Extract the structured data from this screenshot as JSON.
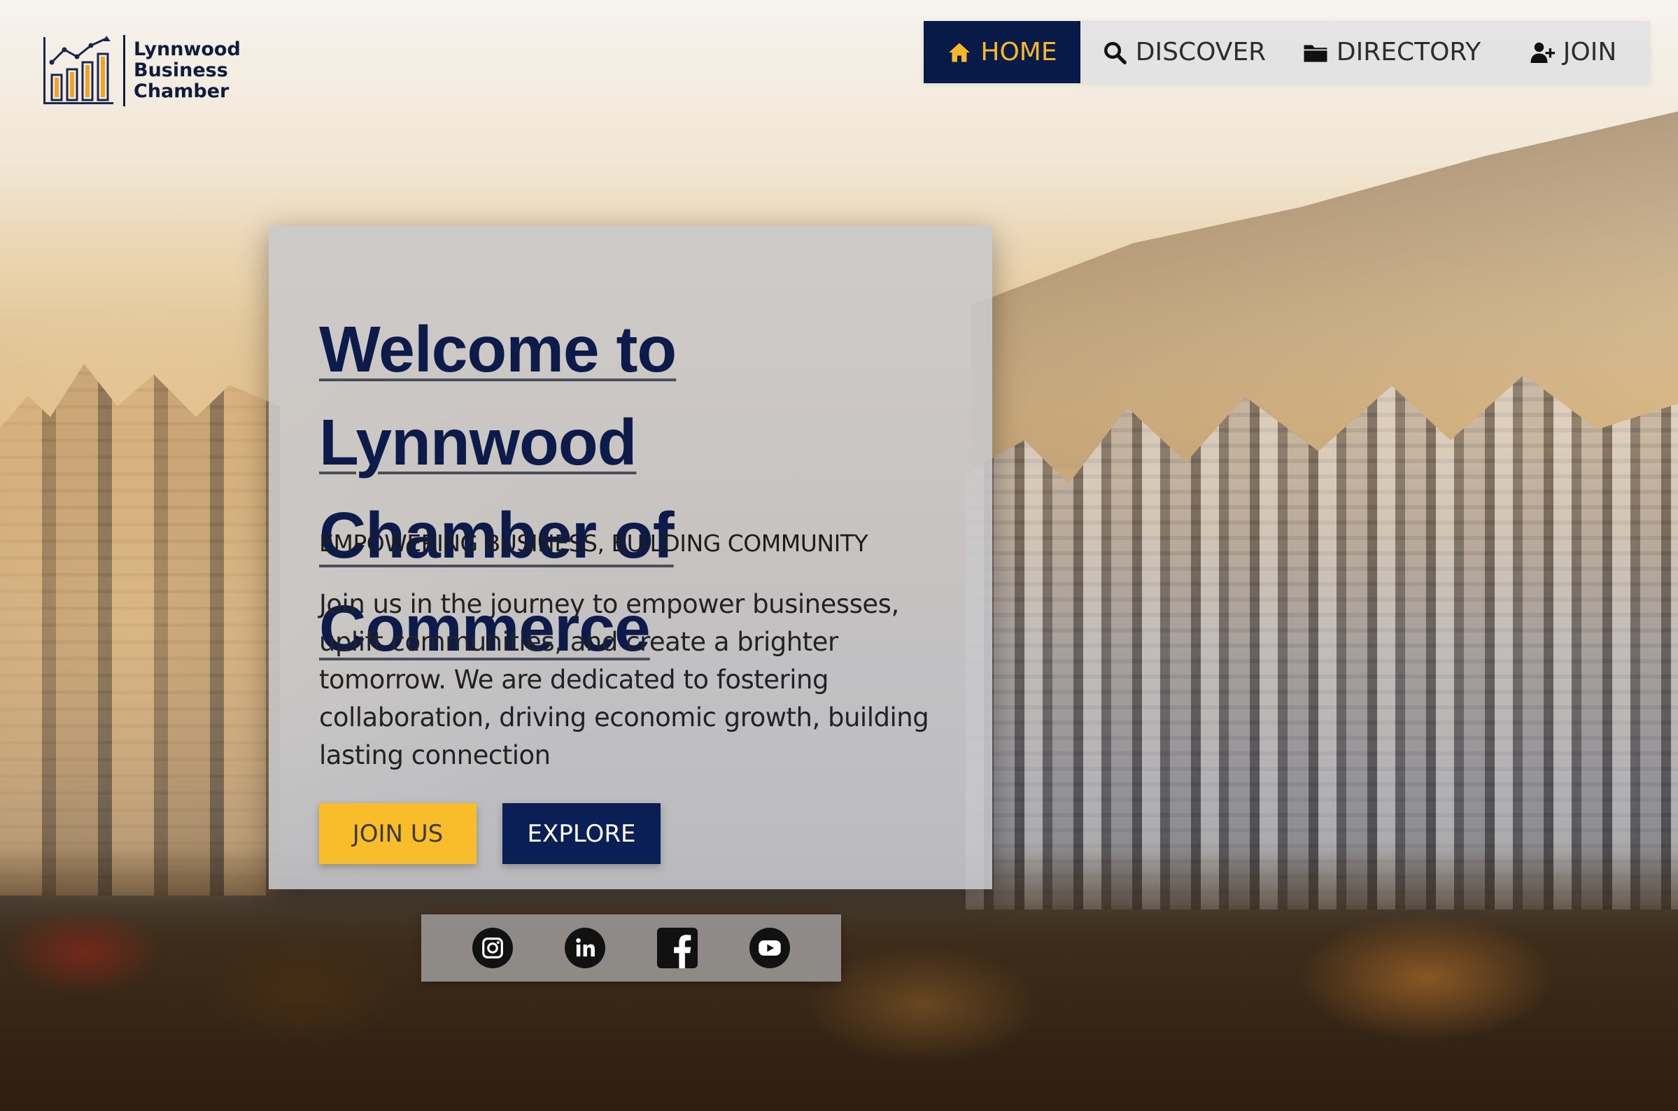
{
  "logo": {
    "line1": "Lynnwood",
    "line2": "Business",
    "line3": "Chamber",
    "icon": "bar-chart-logo-icon"
  },
  "nav": {
    "items": [
      {
        "label": "HOME",
        "icon": "home-icon",
        "active": true
      },
      {
        "label": "DISCOVER",
        "icon": "search-icon",
        "active": false
      },
      {
        "label": "DIRECTORY",
        "icon": "folder-icon",
        "active": false
      },
      {
        "label": "JOIN",
        "icon": "add-user-icon",
        "active": false
      }
    ]
  },
  "hero": {
    "title_line1": "Welcome to Lynnwood",
    "title_line2": "Chamber of Commerce",
    "tagline": "EMPOWERING BUSINESS, BUILDING COMMUNITY",
    "body_lines": [
      "Join us in the journey to empower businesses,",
      "uplift communities, and create a brighter",
      "tomorrow. We are dedicated to fostering",
      "collaboration, driving economic growth, building",
      "lasting connection"
    ],
    "join_button": "JOIN US",
    "explore_button": "EXPLORE"
  },
  "social": {
    "icons": [
      "instagram-icon",
      "linkedin-icon",
      "facebook-icon",
      "youtube-icon"
    ]
  },
  "colors": {
    "navy": "#0b1f57",
    "accent_yellow": "#f9bd2c",
    "nav_bg": "#e2e2e4",
    "card_bg": "#c8c8cc"
  }
}
